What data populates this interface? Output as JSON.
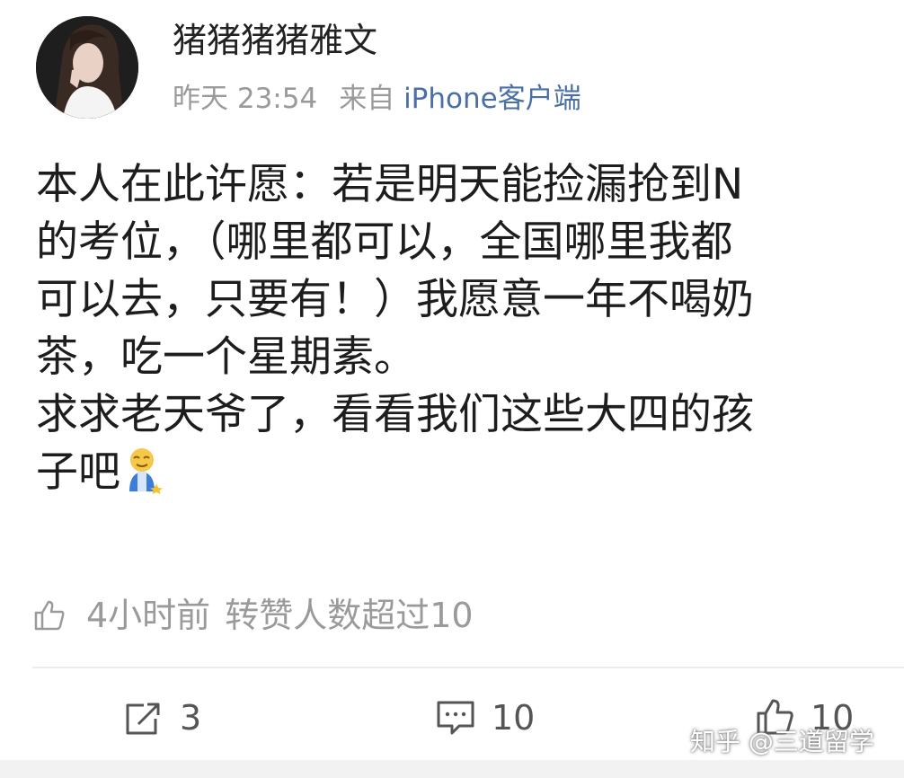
{
  "header": {
    "username": "猪猪猪猪雅文",
    "time": "昨天 23:54",
    "source_prefix": "来自",
    "source_app": "iPhone客户端"
  },
  "content": {
    "lines": [
      "本人在此许愿：若是明天能捡漏抢到N",
      "的考位，（哪里都可以，全国哪里我都",
      "可以去，只要有！）我愿意一年不喝奶",
      "茶，吃一个星期素。",
      "求求老天爷了，看看我们这些大四的孩",
      "子吧"
    ],
    "emoji_icon": "praying-emoji-icon"
  },
  "like_row": {
    "time": "4小时前",
    "info": "转赞人数超过10"
  },
  "actions": {
    "repost_count": "3",
    "comment_count": "10",
    "like_count": "10"
  },
  "watermark": "知乎 @三道留学",
  "colors": {
    "source_link": "#4a6fa5",
    "meta_gray": "#9a9a9a",
    "text": "#1d1d1d"
  }
}
